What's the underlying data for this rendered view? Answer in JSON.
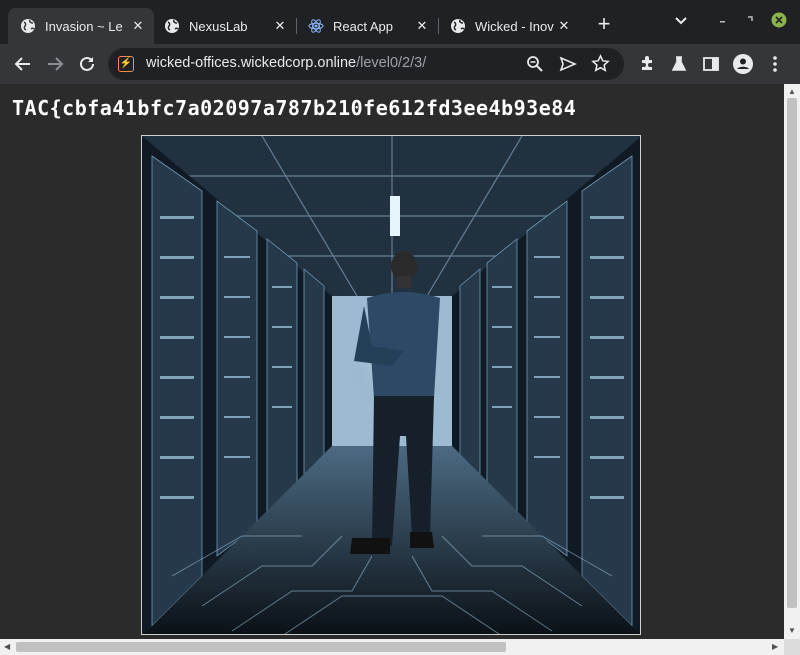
{
  "tabs": [
    {
      "title": "Invasion ~ Le",
      "active": true,
      "icon": "globe-icon"
    },
    {
      "title": "NexusLab",
      "active": false,
      "icon": "globe-icon"
    },
    {
      "title": "React App",
      "active": false,
      "icon": "react-icon"
    },
    {
      "title": "Wicked - Inov",
      "active": false,
      "icon": "globe-icon"
    }
  ],
  "toolbar": {
    "url_host": "wicked-offices.wickedcorp.online",
    "url_path": "/level0/2/3/"
  },
  "page": {
    "flag_text": "TAC{cbfa41bfc7a02097a787b210fe612fd3ee4b93e84",
    "image_alt": "Person standing in a server room corridor"
  },
  "colors": {
    "accent_site_icon": "#f28b50",
    "window_close": "#8ab34a"
  }
}
